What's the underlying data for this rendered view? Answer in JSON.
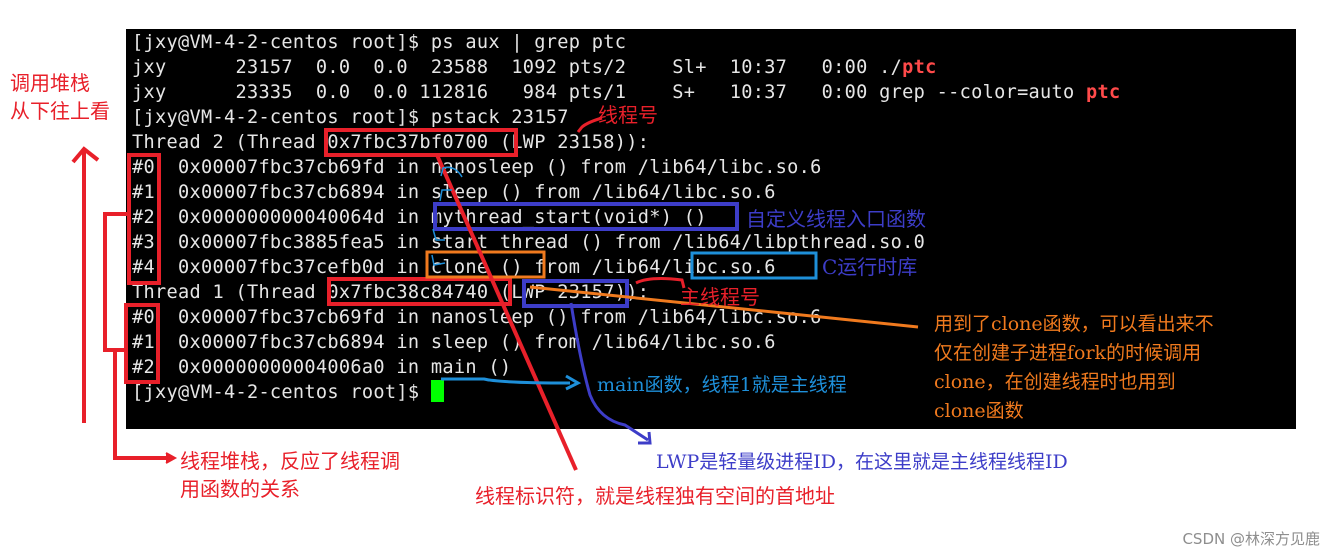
{
  "terminal": {
    "lines": [
      {
        "text": "[jxy@VM-4-2-centos root]$ ps aux | grep ptc"
      },
      {
        "pre": "jxy      23157  0.0  0.0  23588  1092 pts/2    Sl+  10:37   0:00 ./",
        "hl": "ptc",
        "post": ""
      },
      {
        "pre": "jxy      23335  0.0  0.0 112816   984 pts/1    S+   10:37   0:00 grep --color=auto ",
        "hl": "ptc",
        "post": ""
      },
      {
        "text": "[jxy@VM-4-2-centos root]$ pstack 23157"
      },
      {
        "text": "Thread 2 (Thread 0x7fbc37bf0700 (LWP 23158)):"
      },
      {
        "text": "#0  0x00007fbc37cb69fd in nanosleep () from /lib64/libc.so.6"
      },
      {
        "text": "#1  0x00007fbc37cb6894 in sleep () from /lib64/libc.so.6"
      },
      {
        "text": "#2  0x000000000040064d in mythread_start(void*) ()"
      },
      {
        "text": "#3  0x00007fbc3885fea5 in start_thread () from /lib64/libpthread.so.0"
      },
      {
        "text": "#4  0x00007fbc37cefb0d in clone () from /lib64/libc.so.6"
      },
      {
        "text": "Thread 1 (Thread 0x7fbc38c84740 (LWP 23157)):"
      },
      {
        "text": "#0  0x00007fbc37cb69fd in nanosleep () from /lib64/libc.so.6"
      },
      {
        "text": "#1  0x00007fbc37cb6894 in sleep () from /lib64/libc.so.6"
      },
      {
        "text": "#2  0x00000000004006a0 in main ()"
      },
      {
        "text": "[jxy@VM-4-2-centos root]$ "
      }
    ],
    "colors": {
      "background": "#000000",
      "text": "#e6e6e6",
      "highlight": "#ff4a4a",
      "cursor": "#00ff00"
    }
  },
  "annotations": {
    "call_stack_title": "调用堆栈\n从下往上看",
    "thread_number": "线程号",
    "custom_entry": "自定义线程入口函数",
    "c_runtime": "C运行时库",
    "main_thread_number": "主线程号",
    "clone_note": "用到了clone函数，可以看出来不\n仅在创建子进程fork的时候调用\nclone，在创建线程时也用到\nclone函数",
    "main_func": "main函数，线程1就是主线程",
    "thread_stack": "线程堆栈，反应了线程调\n用函数的关系",
    "lwp_note": "LWP是轻量级进程ID，在这里就是主线程线程ID",
    "thread_id_note": "线程标识符，就是线程独有空间的首地址"
  },
  "annotation_colors": {
    "red": "#e8202a",
    "blue": "#3d3dc8",
    "cyan": "#1e8fd9",
    "orange": "#f07a1e"
  },
  "watermark": "CSDN @林深方见鹿"
}
